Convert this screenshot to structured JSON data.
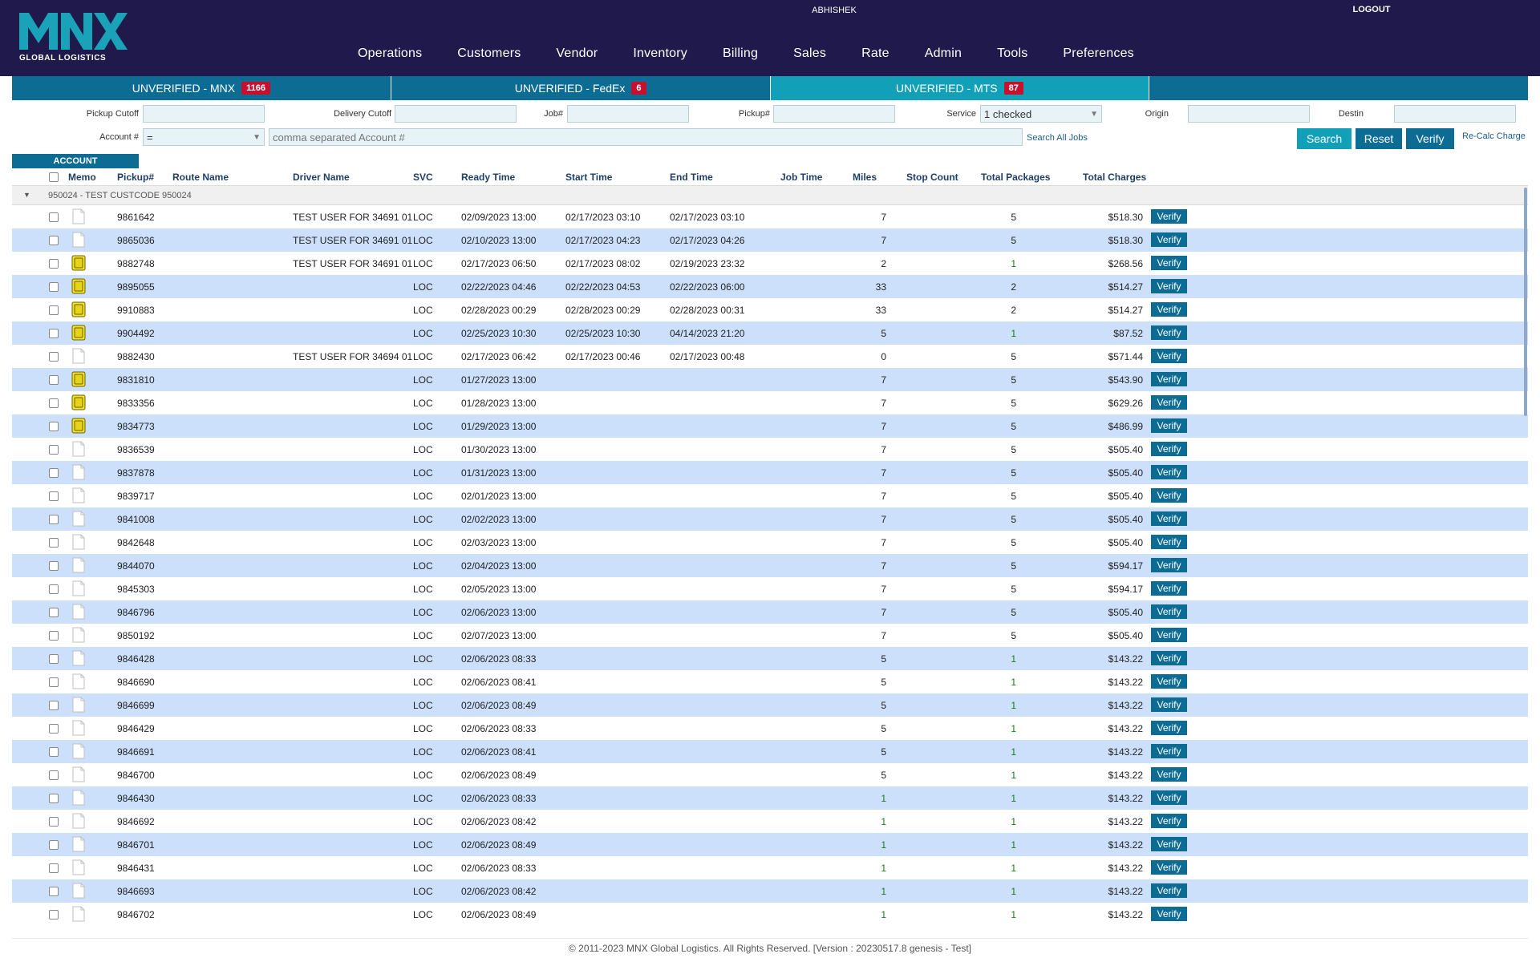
{
  "brand": {
    "name": "MNX",
    "sub": "GLOBAL LOGISTICS",
    "color": "#1aa3b8"
  },
  "user": {
    "name": "ABHISHEK",
    "logout": "LOGOUT"
  },
  "nav": [
    "Operations",
    "Customers",
    "Vendor",
    "Inventory",
    "Billing",
    "Sales",
    "Rate",
    "Admin",
    "Tools",
    "Preferences"
  ],
  "tabs": [
    {
      "label": "UNVERIFIED - MNX",
      "count": "1166"
    },
    {
      "label": "UNVERIFIED - FedEx",
      "count": "6"
    },
    {
      "label": "UNVERIFIED - MTS",
      "count": "87"
    }
  ],
  "filters": {
    "pickup_cutoff": "Pickup Cutoff",
    "delivery_cutoff": "Delivery Cutoff",
    "job": "Job#",
    "pickup": "Pickup#",
    "service": "Service",
    "service_value": "1 checked",
    "origin": "Origin",
    "destin": "Destin",
    "account": "Account #",
    "account_op": "=",
    "account_placeholder": "comma separated Account #",
    "search_all": "Search All Jobs"
  },
  "buttons": {
    "search": "Search",
    "reset": "Reset",
    "verify": "Verify",
    "recalc": "Re-Calc Charge"
  },
  "account_tab": "ACCOUNT",
  "columns": {
    "memo": "Memo",
    "pickup": "Pickup#",
    "route": "Route Name",
    "driver": "Driver Name",
    "svc": "SVC",
    "ready": "Ready Time",
    "start": "Start Time",
    "end": "End Time",
    "job_time": "Job Time",
    "miles": "Miles",
    "stops": "Stop Count",
    "packages": "Total Packages",
    "charges": "Total Charges"
  },
  "group_label": "950024 - TEST CUSTCODE 950024",
  "row_verify_label": "Verify",
  "rows": [
    {
      "memo": false,
      "pickup": "9861642",
      "driver": "TEST USER FOR 34691 01",
      "svc": "LOC",
      "ready": "02/09/2023 13:00",
      "start": "02/17/2023 03:10",
      "end": "02/17/2023 03:10",
      "miles": "7",
      "pk": "5",
      "chg": "$518.30"
    },
    {
      "memo": false,
      "pickup": "9865036",
      "driver": "TEST USER FOR 34691 01",
      "svc": "LOC",
      "ready": "02/10/2023 13:00",
      "start": "02/17/2023 04:23",
      "end": "02/17/2023 04:26",
      "miles": "7",
      "pk": "5",
      "chg": "$518.30"
    },
    {
      "memo": true,
      "pickup": "9882748",
      "driver": "TEST USER FOR 34691 01",
      "svc": "LOC",
      "ready": "02/17/2023 06:50",
      "start": "02/17/2023 08:02",
      "end": "02/19/2023 23:32",
      "miles": "2",
      "pk": "1",
      "chg": "$268.56"
    },
    {
      "memo": true,
      "pickup": "9895055",
      "driver": "",
      "svc": "LOC",
      "ready": "02/22/2023 04:46",
      "start": "02/22/2023 04:53",
      "end": "02/22/2023 06:00",
      "miles": "33",
      "pk": "2",
      "chg": "$514.27"
    },
    {
      "memo": true,
      "pickup": "9910883",
      "driver": "",
      "svc": "LOC",
      "ready": "02/28/2023 00:29",
      "start": "02/28/2023 00:29",
      "end": "02/28/2023 00:31",
      "miles": "33",
      "pk": "2",
      "chg": "$514.27"
    },
    {
      "memo": true,
      "pickup": "9904492",
      "driver": "",
      "svc": "LOC",
      "ready": "02/25/2023 10:30",
      "start": "02/25/2023 10:30",
      "end": "04/14/2023 21:20",
      "miles": "5",
      "pk": "1",
      "chg": "$87.52"
    },
    {
      "memo": false,
      "pickup": "9882430",
      "driver": "TEST USER FOR 34694 01",
      "svc": "LOC",
      "ready": "02/17/2023 06:42",
      "start": "02/17/2023 00:46",
      "end": "02/17/2023 00:48",
      "miles": "0",
      "pk": "5",
      "chg": "$571.44"
    },
    {
      "memo": true,
      "pickup": "9831810",
      "driver": "",
      "svc": "LOC",
      "ready": "01/27/2023 13:00",
      "start": "",
      "end": "",
      "miles": "7",
      "pk": "5",
      "chg": "$543.90"
    },
    {
      "memo": true,
      "pickup": "9833356",
      "driver": "",
      "svc": "LOC",
      "ready": "01/28/2023 13:00",
      "start": "",
      "end": "",
      "miles": "7",
      "pk": "5",
      "chg": "$629.26"
    },
    {
      "memo": true,
      "pickup": "9834773",
      "driver": "",
      "svc": "LOC",
      "ready": "01/29/2023 13:00",
      "start": "",
      "end": "",
      "miles": "7",
      "pk": "5",
      "chg": "$486.99"
    },
    {
      "memo": false,
      "pickup": "9836539",
      "driver": "",
      "svc": "LOC",
      "ready": "01/30/2023 13:00",
      "start": "",
      "end": "",
      "miles": "7",
      "pk": "5",
      "chg": "$505.40"
    },
    {
      "memo": false,
      "pickup": "9837878",
      "driver": "",
      "svc": "LOC",
      "ready": "01/31/2023 13:00",
      "start": "",
      "end": "",
      "miles": "7",
      "pk": "5",
      "chg": "$505.40"
    },
    {
      "memo": false,
      "pickup": "9839717",
      "driver": "",
      "svc": "LOC",
      "ready": "02/01/2023 13:00",
      "start": "",
      "end": "",
      "miles": "7",
      "pk": "5",
      "chg": "$505.40"
    },
    {
      "memo": false,
      "pickup": "9841008",
      "driver": "",
      "svc": "LOC",
      "ready": "02/02/2023 13:00",
      "start": "",
      "end": "",
      "miles": "7",
      "pk": "5",
      "chg": "$505.40"
    },
    {
      "memo": false,
      "pickup": "9842648",
      "driver": "",
      "svc": "LOC",
      "ready": "02/03/2023 13:00",
      "start": "",
      "end": "",
      "miles": "7",
      "pk": "5",
      "chg": "$505.40"
    },
    {
      "memo": false,
      "pickup": "9844070",
      "driver": "",
      "svc": "LOC",
      "ready": "02/04/2023 13:00",
      "start": "",
      "end": "",
      "miles": "7",
      "pk": "5",
      "chg": "$594.17"
    },
    {
      "memo": false,
      "pickup": "9845303",
      "driver": "",
      "svc": "LOC",
      "ready": "02/05/2023 13:00",
      "start": "",
      "end": "",
      "miles": "7",
      "pk": "5",
      "chg": "$594.17"
    },
    {
      "memo": false,
      "pickup": "9846796",
      "driver": "",
      "svc": "LOC",
      "ready": "02/06/2023 13:00",
      "start": "",
      "end": "",
      "miles": "7",
      "pk": "5",
      "chg": "$505.40"
    },
    {
      "memo": false,
      "pickup": "9850192",
      "driver": "",
      "svc": "LOC",
      "ready": "02/07/2023 13:00",
      "start": "",
      "end": "",
      "miles": "7",
      "pk": "5",
      "chg": "$505.40"
    },
    {
      "memo": false,
      "pickup": "9846428",
      "driver": "",
      "svc": "LOC",
      "ready": "02/06/2023 08:33",
      "start": "",
      "end": "",
      "miles": "5",
      "pk": "1",
      "chg": "$143.22"
    },
    {
      "memo": false,
      "pickup": "9846690",
      "driver": "",
      "svc": "LOC",
      "ready": "02/06/2023 08:41",
      "start": "",
      "end": "",
      "miles": "5",
      "pk": "1",
      "chg": "$143.22"
    },
    {
      "memo": false,
      "pickup": "9846699",
      "driver": "",
      "svc": "LOC",
      "ready": "02/06/2023 08:49",
      "start": "",
      "end": "",
      "miles": "5",
      "pk": "1",
      "chg": "$143.22"
    },
    {
      "memo": false,
      "pickup": "9846429",
      "driver": "",
      "svc": "LOC",
      "ready": "02/06/2023 08:33",
      "start": "",
      "end": "",
      "miles": "5",
      "pk": "1",
      "chg": "$143.22"
    },
    {
      "memo": false,
      "pickup": "9846691",
      "driver": "",
      "svc": "LOC",
      "ready": "02/06/2023 08:41",
      "start": "",
      "end": "",
      "miles": "5",
      "pk": "1",
      "chg": "$143.22"
    },
    {
      "memo": false,
      "pickup": "9846700",
      "driver": "",
      "svc": "LOC",
      "ready": "02/06/2023 08:49",
      "start": "",
      "end": "",
      "miles": "5",
      "pk": "1",
      "chg": "$143.22"
    },
    {
      "memo": false,
      "pickup": "9846430",
      "driver": "",
      "svc": "LOC",
      "ready": "02/06/2023 08:33",
      "start": "",
      "end": "",
      "miles": "1",
      "pk": "1",
      "chg": "$143.22"
    },
    {
      "memo": false,
      "pickup": "9846692",
      "driver": "",
      "svc": "LOC",
      "ready": "02/06/2023 08:42",
      "start": "",
      "end": "",
      "miles": "1",
      "pk": "1",
      "chg": "$143.22"
    },
    {
      "memo": false,
      "pickup": "9846701",
      "driver": "",
      "svc": "LOC",
      "ready": "02/06/2023 08:49",
      "start": "",
      "end": "",
      "miles": "1",
      "pk": "1",
      "chg": "$143.22"
    },
    {
      "memo": false,
      "pickup": "9846431",
      "driver": "",
      "svc": "LOC",
      "ready": "02/06/2023 08:33",
      "start": "",
      "end": "",
      "miles": "1",
      "pk": "1",
      "chg": "$143.22"
    },
    {
      "memo": false,
      "pickup": "9846693",
      "driver": "",
      "svc": "LOC",
      "ready": "02/06/2023 08:42",
      "start": "",
      "end": "",
      "miles": "1",
      "pk": "1",
      "chg": "$143.22"
    },
    {
      "memo": false,
      "pickup": "9846702",
      "driver": "",
      "svc": "LOC",
      "ready": "02/06/2023 08:49",
      "start": "",
      "end": "",
      "miles": "1",
      "pk": "1",
      "chg": "$143.22"
    }
  ],
  "footer": "© 2011-2023 MNX Global Logistics. All Rights Reserved. [Version : 20230517.8 genesis - Test]"
}
